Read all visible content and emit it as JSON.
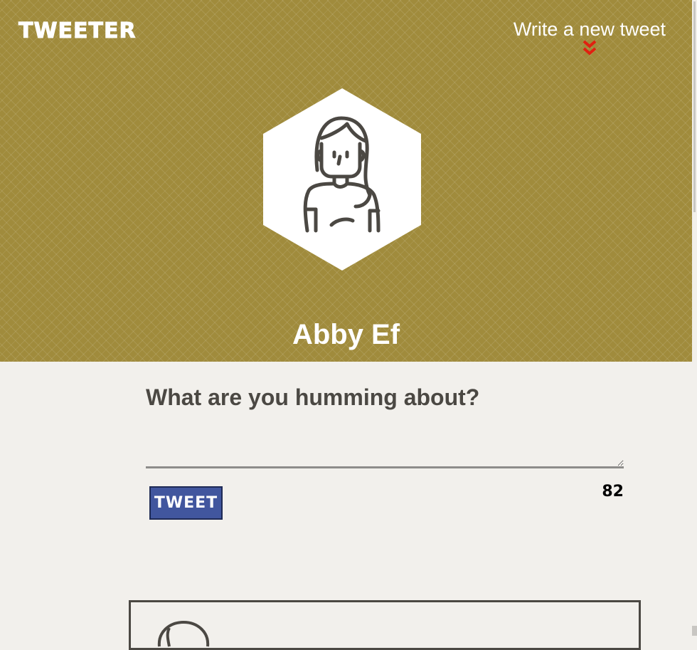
{
  "nav": {
    "logo": "TWEETER",
    "compose_label": "Write a new tweet",
    "compose_arrow_icon": "double-chevron-down-icon",
    "arrow_color": "#e02010"
  },
  "profile": {
    "name": "Abby Ef",
    "avatar_icon": "woman-avatar-icon"
  },
  "composer": {
    "prompt": "What are you humming about?",
    "input_value": "",
    "button_label": "TWEET",
    "char_count": "82"
  },
  "colors": {
    "header_bg": "#a08b3c",
    "page_bg": "#f2f0ec",
    "button_bg": "#41569e",
    "text_dark": "#4b4843"
  }
}
